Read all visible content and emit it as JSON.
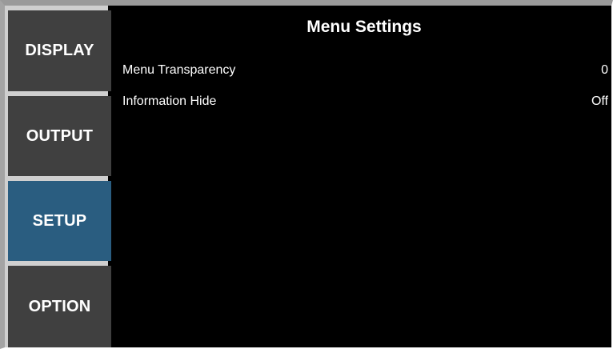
{
  "tabs": [
    {
      "label": "DISPLAY",
      "selected": false
    },
    {
      "label": "OUTPUT",
      "selected": false
    },
    {
      "label": "SETUP",
      "selected": true
    },
    {
      "label": "OPTION",
      "selected": false
    }
  ],
  "panel": {
    "title": "Menu Settings",
    "settings": [
      {
        "label": "Menu Transparency",
        "value": "0"
      },
      {
        "label": "Information Hide",
        "value": "Off"
      }
    ]
  },
  "colors": {
    "background": "#000000",
    "tab": "#404040",
    "tab_selected": "#2a5d80",
    "text": "#ffffff"
  }
}
